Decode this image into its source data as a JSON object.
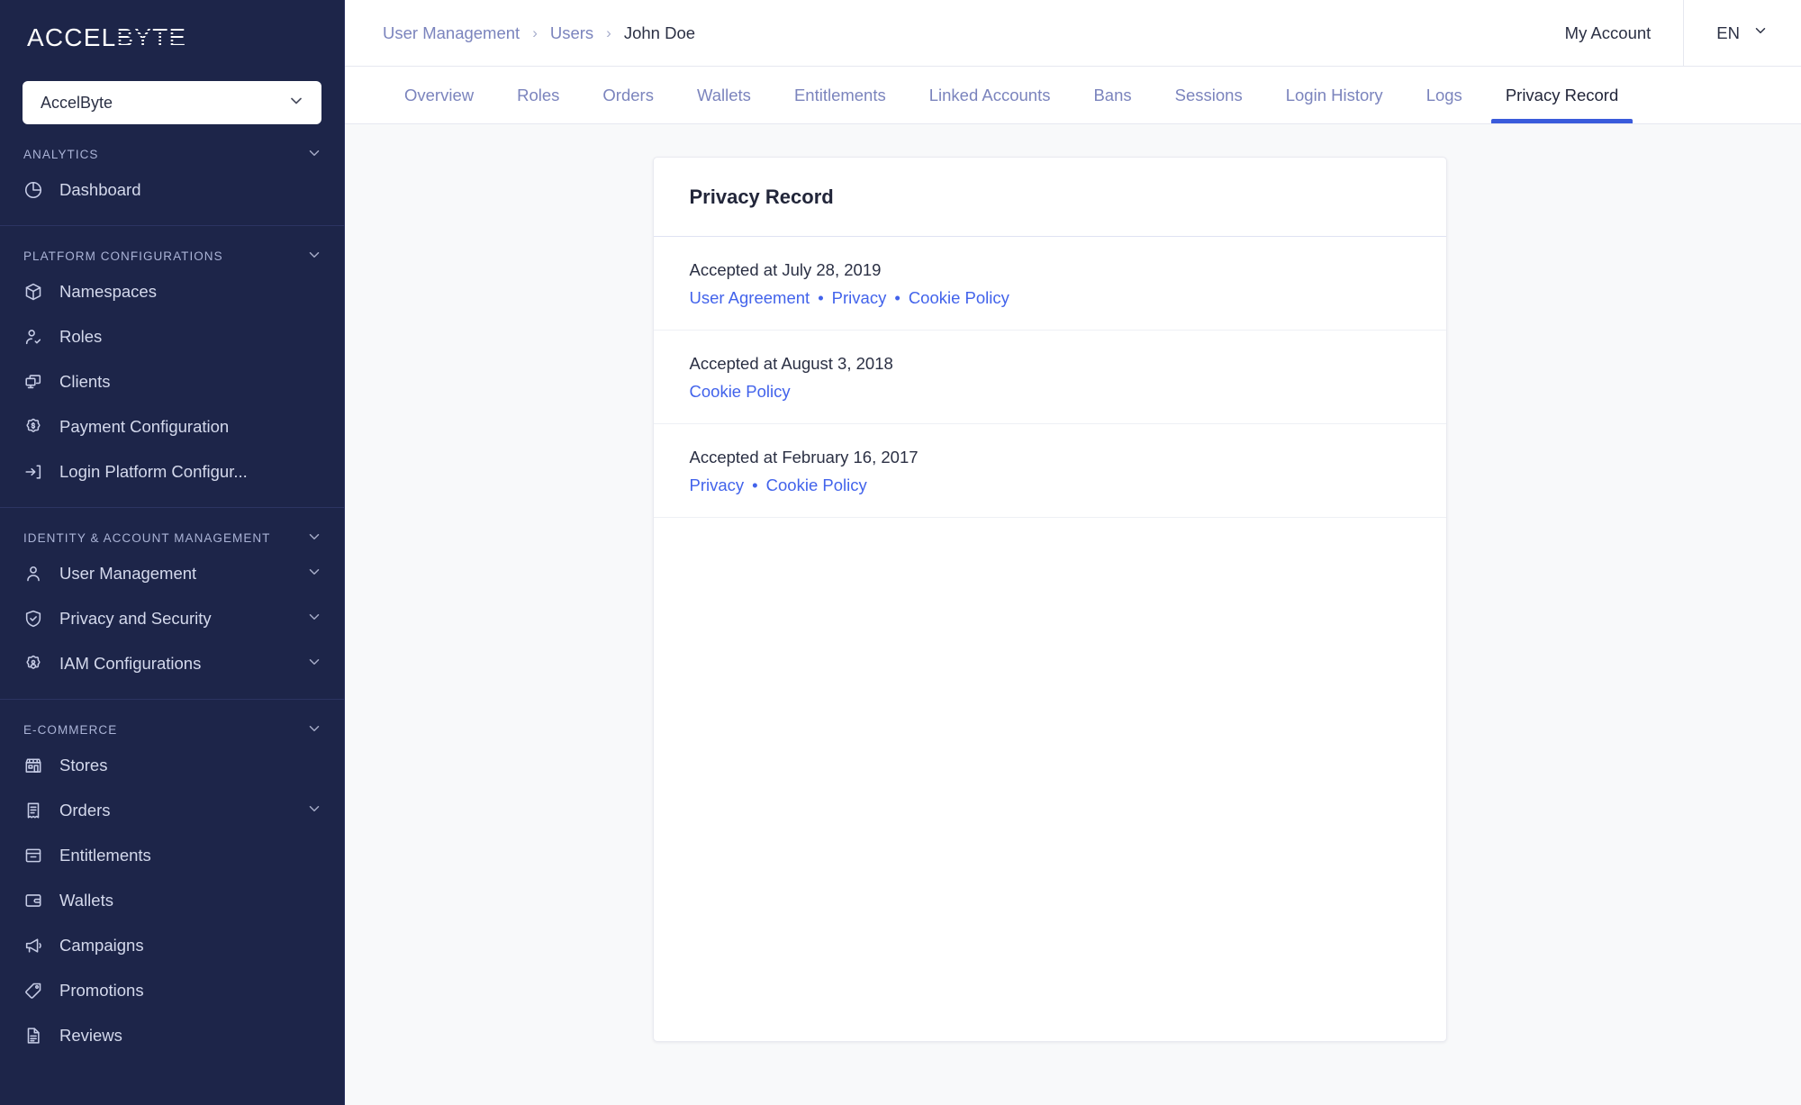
{
  "brand": {
    "logo_accel": "ACCEL",
    "logo_byte": "BYTE",
    "namespace_value": "AccelByte",
    "accent_color": "#3a5bdb",
    "link_color": "#4263eb",
    "sidebar_bg": "#1d2549"
  },
  "sidebar": {
    "sections": [
      {
        "title": "ANALYTICS",
        "items": [
          {
            "label": "Dashboard",
            "icon": "pie-chart-icon",
            "expandable": false
          }
        ]
      },
      {
        "title": "PLATFORM CONFIGURATIONS",
        "items": [
          {
            "label": "Namespaces",
            "icon": "cube-icon",
            "expandable": false
          },
          {
            "label": "Roles",
            "icon": "user-check-icon",
            "expandable": false
          },
          {
            "label": "Clients",
            "icon": "screens-icon",
            "expandable": false
          },
          {
            "label": "Payment Configuration",
            "icon": "gear-dollar-icon",
            "expandable": false
          },
          {
            "label": "Login Platform Configur...",
            "icon": "login-arrow-icon",
            "expandable": false
          }
        ]
      },
      {
        "title": "IDENTITY & ACCOUNT MANAGEMENT",
        "items": [
          {
            "label": "User Management",
            "icon": "user-icon",
            "expandable": true
          },
          {
            "label": "Privacy and Security",
            "icon": "shield-check-icon",
            "expandable": true
          },
          {
            "label": "IAM Configurations",
            "icon": "gear-user-icon",
            "expandable": true
          }
        ]
      },
      {
        "title": "E-COMMERCE",
        "items": [
          {
            "label": "Stores",
            "icon": "store-icon",
            "expandable": false
          },
          {
            "label": "Orders",
            "icon": "receipt-icon",
            "expandable": true
          },
          {
            "label": "Entitlements",
            "icon": "archive-icon",
            "expandable": false
          },
          {
            "label": "Wallets",
            "icon": "wallet-icon",
            "expandable": false
          },
          {
            "label": "Campaigns",
            "icon": "megaphone-icon",
            "expandable": false
          },
          {
            "label": "Promotions",
            "icon": "tag-icon",
            "expandable": false
          },
          {
            "label": "Reviews",
            "icon": "document-icon",
            "expandable": false
          }
        ]
      }
    ]
  },
  "topbar": {
    "breadcrumb": [
      {
        "label": "User Management",
        "current": false
      },
      {
        "label": "Users",
        "current": false
      },
      {
        "label": "John Doe",
        "current": true
      }
    ],
    "separator": "›",
    "my_account": "My Account",
    "language": "EN"
  },
  "tabs": [
    {
      "label": "Overview",
      "active": false
    },
    {
      "label": "Roles",
      "active": false
    },
    {
      "label": "Orders",
      "active": false
    },
    {
      "label": "Wallets",
      "active": false
    },
    {
      "label": "Entitlements",
      "active": false
    },
    {
      "label": "Linked Accounts",
      "active": false
    },
    {
      "label": "Bans",
      "active": false
    },
    {
      "label": "Sessions",
      "active": false
    },
    {
      "label": "Login History",
      "active": false
    },
    {
      "label": "Logs",
      "active": false
    },
    {
      "label": "Privacy Record",
      "active": true
    }
  ],
  "card": {
    "title": "Privacy Record",
    "rows": [
      {
        "date_text": "Accepted at July 28, 2019",
        "links": [
          "User Agreement",
          "Privacy",
          "Cookie Policy"
        ]
      },
      {
        "date_text": "Accepted at August 3, 2018",
        "links": [
          "Cookie Policy"
        ]
      },
      {
        "date_text": "Accepted at February 16, 2017",
        "links": [
          "Privacy",
          "Cookie Policy"
        ]
      }
    ],
    "link_separator": "•"
  }
}
